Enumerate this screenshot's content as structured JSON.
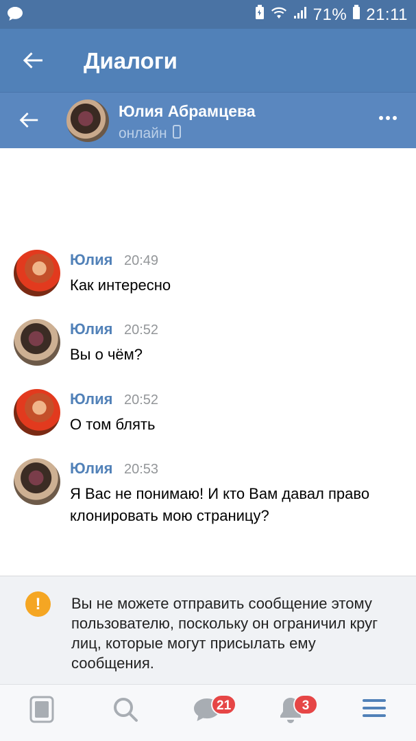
{
  "status_bar": {
    "battery": "71%",
    "time": "21:11"
  },
  "app_bar": {
    "title": "Диалоги"
  },
  "chat_header": {
    "name": "Юлия Абрамцева",
    "status": "онлайн"
  },
  "messages": [
    {
      "author": "Юлия",
      "time": "20:49",
      "text": "Как интересно",
      "avatar": "red"
    },
    {
      "author": "Юлия",
      "time": "20:52",
      "text": "Вы о чём?",
      "avatar": "dark"
    },
    {
      "author": "Юлия",
      "time": "20:52",
      "text": "О том блять",
      "avatar": "red"
    },
    {
      "author": "Юлия",
      "time": "20:53",
      "text": "Я Вас не понимаю! И кто Вам давал право клонировать мою страницу?",
      "avatar": "dark"
    }
  ],
  "warning": {
    "icon": "!",
    "text": "Вы не можете отправить сообщение этому пользователю, поскольку он ограничил круг лиц, которые могут присылать ему сообщения."
  },
  "bottom_nav": {
    "messages_count": "21",
    "notifications_count": "3"
  },
  "colors": {
    "status_bar": "#4a73a4",
    "app_bar": "#5181b8",
    "chat_header": "#5a87bf",
    "author_name": "#5181b8",
    "warning_icon": "#f5a623",
    "badge": "#e64646"
  }
}
